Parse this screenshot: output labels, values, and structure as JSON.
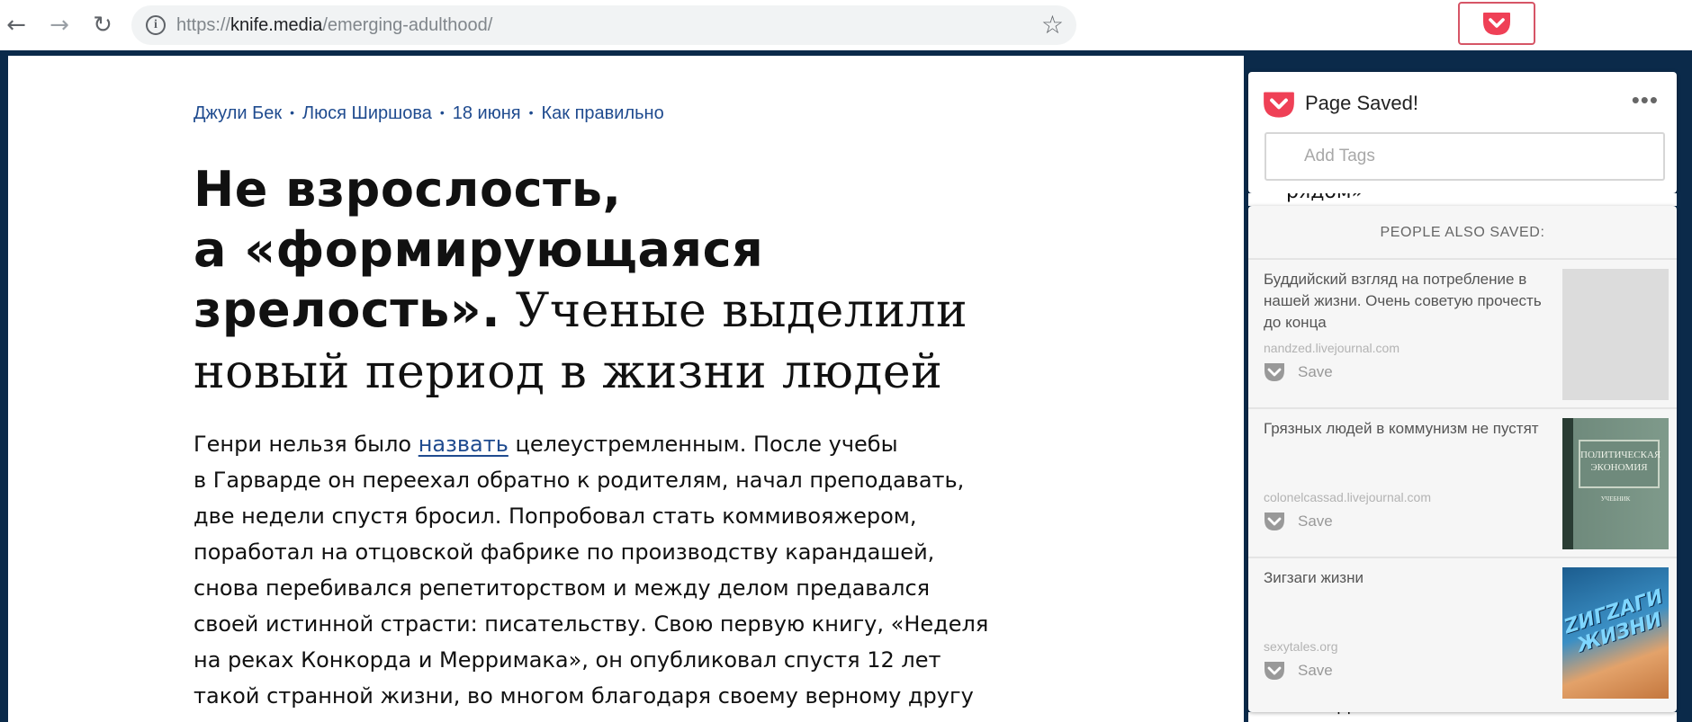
{
  "browser": {
    "url_scheme": "https://",
    "url_host": "knife.media",
    "url_path": "/emerging-adulthood/",
    "back_label": "←",
    "forward_label": "→",
    "reload_label": "↻",
    "info_glyph": "i",
    "star_glyph": "☆"
  },
  "article": {
    "authors": [
      "Джули Бек",
      "Люся Ширшова"
    ],
    "date": "18 июня",
    "section": "Как правильно",
    "separator": "•",
    "headline_bold": [
      "Не взрослость,",
      "а «формирующаяся",
      "зрелость»."
    ],
    "headline_serif_1": "Ученые выделили",
    "headline_serif_2": "новый период в жизни людей",
    "body_line1_pre": "Генри нельзя было ",
    "body_line1_link": "назвать",
    "body_line1_post": " целеустремленным. После учебы",
    "body_lines": [
      "в Гарварде он переехал обратно к родителям, начал преподавать,",
      "две недели спустя бросил. Попробовал стать коммивояжером,",
      "поработал на отцовской фабрике по производству карандашей,",
      "снова перебивался репетиторством и между делом предавался",
      "своей истинной страсти: писательству. Свою первую книгу, «Неделя",
      "на реках Конкорда и Мерримака», он опубликовал спустя 12 лет",
      "такой странной жизни, во многом благодаря своему верному другу"
    ]
  },
  "site_sidebar": {
    "fragment_top": "рядом»",
    "fragment_bottom": "Находка: записные книжки"
  },
  "pocket": {
    "title": "Page Saved!",
    "more_label": "•••",
    "tags_placeholder": "Add Tags",
    "recs_header": "PEOPLE ALSO SAVED:",
    "save_label": "Save",
    "brand_color": "#ef4056",
    "recs": [
      {
        "title": "Буддийский взгляд на потребление в нашей жизни. Очень советую прочесть до конца",
        "domain": "nandzed.livejournal.com"
      },
      {
        "title": "Грязных людей в коммунизм не пустят",
        "domain": "colonelcassad.livejournal.com",
        "thumb_text": "ПОЛИТИЧЕСКАЯ ЭКОНОМИЯ",
        "thumb_sub": "УЧЕБНИК"
      },
      {
        "title": "Зигзаги жизни",
        "domain": "sexytales.org",
        "thumb_text": "ZИГZАГИ ЖИЗНИ"
      }
    ]
  }
}
